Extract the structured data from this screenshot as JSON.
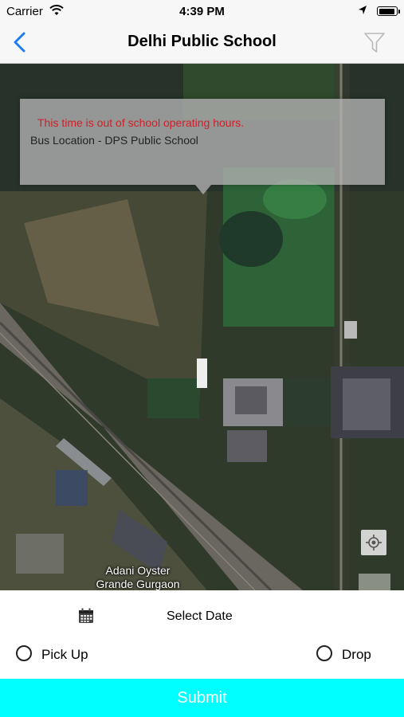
{
  "status_bar": {
    "carrier": "Carrier",
    "time": "4:39 PM",
    "wifi_icon": "wifi-icon",
    "location_icon": "location-arrow-icon",
    "battery_level": 0.95
  },
  "nav": {
    "title": "Delhi Public School",
    "back_icon": "chevron-left-icon",
    "filter_icon": "filter-icon",
    "accent_color": "#1e7cf2"
  },
  "map": {
    "callout": {
      "warning": "This time is out of school operating hours.",
      "location": "Bus Location - DPS Public School",
      "warning_color": "#d0202a"
    },
    "place_label_line1": "Adani Oyster",
    "place_label_line2": "Grande Gurgaon",
    "locate_icon": "crosshair-icon"
  },
  "bottom": {
    "calendar_icon": "calendar-icon",
    "select_date_label": "Select Date",
    "pickup_label": "Pick Up",
    "drop_label": "Drop",
    "pickup_selected": false,
    "drop_selected": false
  },
  "submit": {
    "label": "Submit",
    "color": "#00ffff"
  }
}
